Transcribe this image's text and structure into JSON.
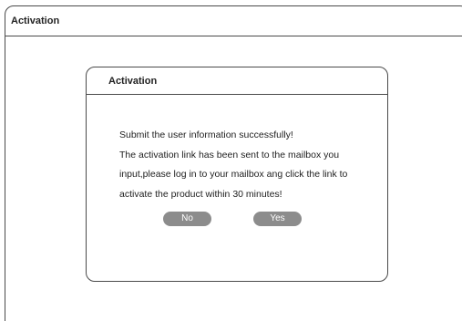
{
  "window": {
    "title": "Activation"
  },
  "dialog": {
    "title": "Activation",
    "message_lines": [
      "Submit the user information successfully!",
      "The activation link has been sent to the mailbox you",
      "input,please log in to your mailbox ang click the link to",
      "activate the product within 30 minutes!"
    ],
    "no_label": "No",
    "yes_label": "Yes"
  }
}
